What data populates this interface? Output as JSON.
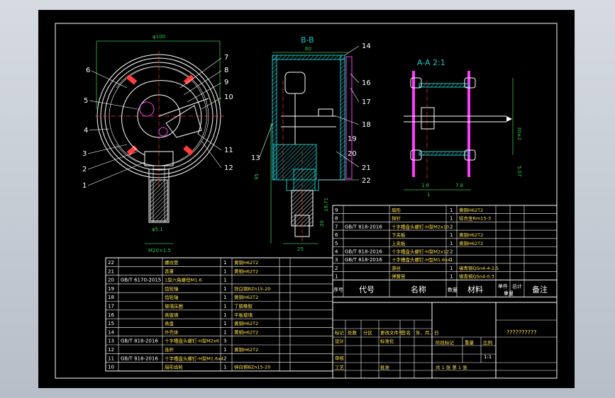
{
  "front_view": {
    "dim_top": "φ100",
    "balloons": [
      "1",
      "2",
      "3",
      "4",
      "5",
      "6",
      "7",
      "8",
      "9",
      "10",
      "11",
      "12"
    ],
    "dim_bottom1": "φ5.1",
    "dim_bottom2": "M20×1.5"
  },
  "section_bb": {
    "title": "B-B",
    "dim_top": "60",
    "dim_left": "95",
    "dim_bottom": "25",
    "dim_right1": "19.71",
    "dim_right2": "20",
    "balloons": [
      "14",
      "16",
      "17",
      "18",
      "19",
      "20",
      "21",
      "22",
      "13"
    ]
  },
  "section_aa": {
    "title": "A-A 2:1",
    "dim_right": "30±2",
    "dim_right2": "5.07",
    "dim_bottom1": "7.8",
    "dim_bottom2": "1.6",
    "dim_bottom3": "1"
  },
  "bom_right": {
    "rows": [
      {
        "no": "9",
        "code": "",
        "name": "扇形",
        "qty": "1",
        "material": "黄铜H62T2",
        "remark": ""
      },
      {
        "no": "8",
        "code": "",
        "name": "指针",
        "qty": "1",
        "material": "铝合金Rm15-3",
        "remark": ""
      },
      {
        "no": "7",
        "code": "GB/T 818-2016",
        "name": "十字槽盘头螺钉-H型M2x10",
        "qty": "2",
        "material": "",
        "remark": ""
      },
      {
        "no": "6",
        "code": "",
        "name": "下夹板",
        "qty": "1",
        "material": "黄铜H62T2",
        "remark": ""
      },
      {
        "no": "5",
        "code": "",
        "name": "上夹板",
        "qty": "1",
        "material": "黄铜H62T2",
        "remark": ""
      },
      {
        "no": "4",
        "code": "GB/T 818-2016",
        "name": "十字槽盘头螺钉-H型M2x12",
        "qty": "2",
        "material": "",
        "remark": ""
      },
      {
        "no": "3",
        "code": "GB/T 818-2016",
        "name": "十字槽盘头螺钉-H型M1.6x4",
        "qty": "1",
        "material": "",
        "remark": ""
      },
      {
        "no": "2",
        "code": "",
        "name": "游丝",
        "qty": "1",
        "material": "锡青铜QSn4-4-2.5",
        "remark": ""
      },
      {
        "no": "1",
        "code": "",
        "name": "弹簧管",
        "qty": "1",
        "material": "锡青铜QSn4-0.3",
        "remark": ""
      }
    ],
    "header": {
      "no": "序号",
      "code": "代号",
      "name": "名称",
      "qty": "数量",
      "material": "材料",
      "unit": "单件",
      "total": "总计",
      "weight": "重量",
      "remark": "备注"
    }
  },
  "bom_left": {
    "rows": [
      {
        "no": "22",
        "code": "",
        "name": "螺纹管",
        "qty": "1",
        "material": "黄铜H62T2"
      },
      {
        "no": "21",
        "code": "",
        "name": "表罩",
        "qty": "1",
        "material": "黄铜H62T2"
      },
      {
        "no": "20",
        "code": "GB/T 6170-2015",
        "name": "1型六角螺母M1.6",
        "qty": "1",
        "material": ""
      },
      {
        "no": "19",
        "code": "",
        "name": "齿轮轴",
        "qty": "1",
        "material": "锌白铜BZn15-20"
      },
      {
        "no": "18",
        "code": "",
        "name": "齿轮轴",
        "qty": "1",
        "material": "黄铜H62T2"
      },
      {
        "no": "17",
        "code": "",
        "name": "玻璃压圈",
        "qty": "1",
        "material": "丁腈橡胶"
      },
      {
        "no": "16",
        "code": "",
        "name": "表玻璃",
        "qty": "1",
        "material": "平板玻璃"
      },
      {
        "no": "15",
        "code": "",
        "name": "表盘",
        "qty": "1",
        "material": "黄铜H62T2"
      },
      {
        "no": "14",
        "code": "",
        "name": "外壳体",
        "qty": "1",
        "material": "黄铜H62T2"
      },
      {
        "no": "13",
        "code": "GB/T 818-2016",
        "name": "十字槽盘头螺钉-H型M2x6",
        "qty": "3",
        "material": ""
      },
      {
        "no": "12",
        "code": "",
        "name": "连杆",
        "qty": "1",
        "material": "黄铜H62T2"
      },
      {
        "no": "11",
        "code": "GB/T 818-2016",
        "name": "十字槽盘头螺钉-H型M1.6x4",
        "qty": "2",
        "material": ""
      },
      {
        "no": "10",
        "code": "",
        "name": "扇形齿轮",
        "qty": "1",
        "material": "锌白铜BZn15-20"
      }
    ]
  },
  "title_block": {
    "drawing_name": "??????????",
    "labels": {
      "mark": "标记",
      "count": "处数",
      "zone": "分区",
      "doc": "更改文件号",
      "sign": "签名",
      "date": "年、月、日",
      "design": "设计",
      "standard": "标准化",
      "stage": "阶段标记",
      "weight": "重量",
      "scale": "比例",
      "scale_val": "1:1",
      "review": "审核",
      "process": "工艺",
      "approve": "批准",
      "sheets": "共  1  张   第  1  张"
    }
  }
}
